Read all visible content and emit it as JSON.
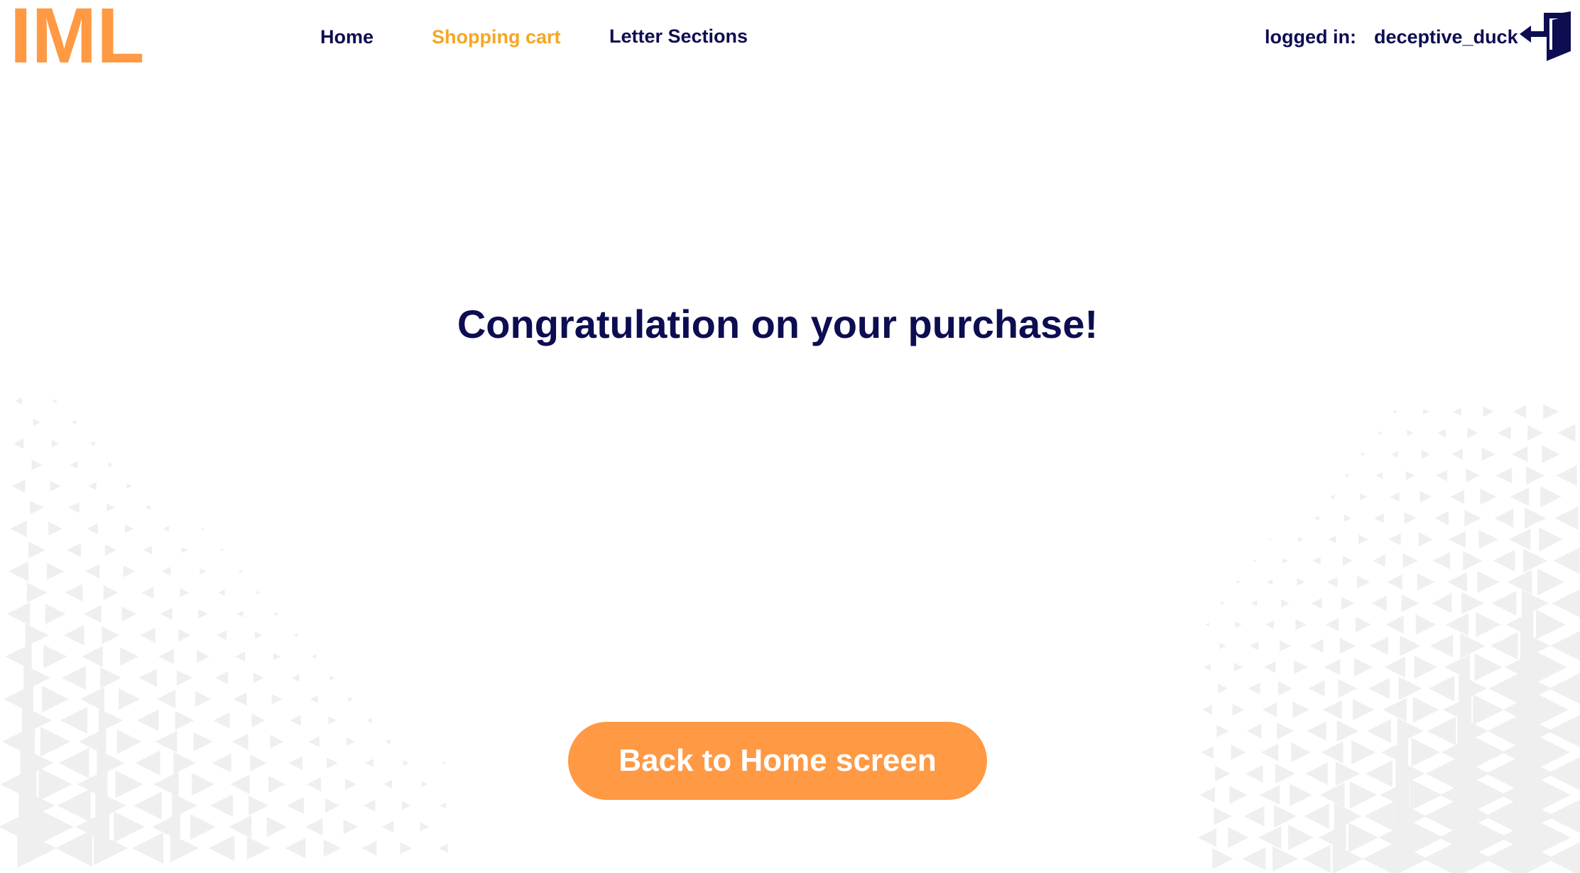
{
  "header": {
    "logo": "IML",
    "nav": {
      "home": "Home",
      "shopping_cart": "Shopping cart",
      "letter_sections": "Letter Sections"
    },
    "active_nav": "shopping_cart",
    "login_label": "logged in:",
    "username": "deceptive_duck",
    "logout_icon": "logout-door-icon"
  },
  "main": {
    "heading": "Congratulation on your purchase!",
    "home_button_label": "Back to Home screen"
  },
  "colors": {
    "brand_orange": "#FF9944",
    "active_nav": "#F5A623",
    "navy_text": "#0D0D52",
    "pattern": "#EFEFEF"
  },
  "background": "triangle-pattern"
}
